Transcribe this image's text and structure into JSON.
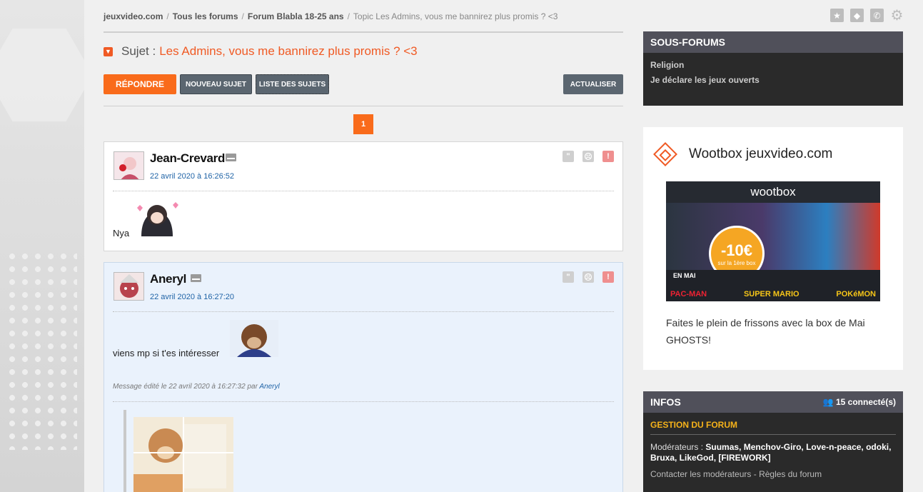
{
  "breadcrumb": {
    "site": "jeuxvideo.com",
    "all_forums": "Tous les forums",
    "forum": "Forum Blabla 18-25 ans",
    "topic": "Topic Les Admins, vous me bannirez plus promis ? <3"
  },
  "topic": {
    "label": "Sujet :",
    "title": "Les Admins, vous me bannirez plus promis ? <3"
  },
  "toolbar": {
    "reply": "RÉPONDRE",
    "new_topic": "NOUVEAU SUJET",
    "topic_list": "LISTE DES SUJETS",
    "refresh": "ACTUALISER"
  },
  "pager": {
    "current": "1"
  },
  "posts": [
    {
      "author": "Jean-Crevard",
      "date": "22 avril 2020 à 16:26:52",
      "text": "Nya"
    },
    {
      "author": "Aneryl",
      "date": "22 avril 2020 à 16:27:20",
      "text": "viens mp si t'es intéresser",
      "edited_prefix": "Message édité le 22 avril 2020 à 16:27:32 par",
      "edited_by": "Aneryl"
    }
  ],
  "sidebar": {
    "subforums_title": "SOUS-FORUMS",
    "subforums": [
      "Religion",
      "Je déclare les jeux ouverts"
    ],
    "wootbox_title": "Wootbox jeuxvideo.com",
    "banner": {
      "brand": "wootbox",
      "discount": "-10€",
      "discount_sub": "sur la 1ère box",
      "month": "EN MAI",
      "brands": [
        "PAC-MAN",
        "SUPER MARIO",
        "POKéMON"
      ]
    },
    "wootbox_desc": "Faites le plein de frissons avec la box de Mai GHOSTS!",
    "infos_title": "INFOS",
    "connected": "15 connecté(s)",
    "gestion_title": "GESTION DU FORUM",
    "mods_label": "Modérateurs :",
    "mods": "Suumas, Menchov-Giro, Love-n-peace, odoki, Bruxa, LikeGod, [FIREWORK]",
    "contact": "Contacter les modérateurs - Règles du forum"
  }
}
